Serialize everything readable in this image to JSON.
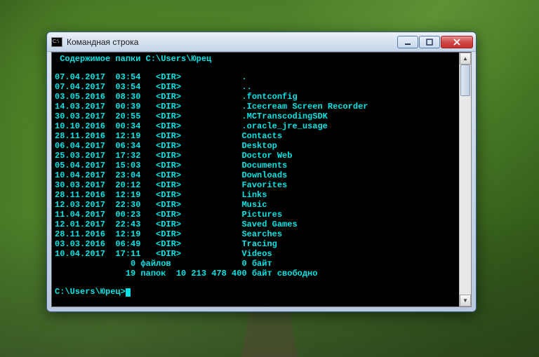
{
  "window": {
    "title": "Командная строка",
    "icon_label": "C:\\"
  },
  "console": {
    "header": "Содержимое папки C:\\Users\\Юрец",
    "entries": [
      {
        "date": "07.04.2017",
        "time": "03:54",
        "type": "<DIR>",
        "name": "."
      },
      {
        "date": "07.04.2017",
        "time": "03:54",
        "type": "<DIR>",
        "name": ".."
      },
      {
        "date": "03.05.2016",
        "time": "08:30",
        "type": "<DIR>",
        "name": ".fontconfig"
      },
      {
        "date": "14.03.2017",
        "time": "00:39",
        "type": "<DIR>",
        "name": ".Icecream Screen Recorder"
      },
      {
        "date": "30.03.2017",
        "time": "20:55",
        "type": "<DIR>",
        "name": ".MCTranscodingSDK"
      },
      {
        "date": "10.10.2016",
        "time": "00:34",
        "type": "<DIR>",
        "name": ".oracle_jre_usage"
      },
      {
        "date": "28.11.2016",
        "time": "12:19",
        "type": "<DIR>",
        "name": "Contacts"
      },
      {
        "date": "06.04.2017",
        "time": "06:34",
        "type": "<DIR>",
        "name": "Desktop"
      },
      {
        "date": "25.03.2017",
        "time": "17:32",
        "type": "<DIR>",
        "name": "Doctor Web"
      },
      {
        "date": "05.04.2017",
        "time": "15:03",
        "type": "<DIR>",
        "name": "Documents"
      },
      {
        "date": "10.04.2017",
        "time": "23:04",
        "type": "<DIR>",
        "name": "Downloads"
      },
      {
        "date": "30.03.2017",
        "time": "20:12",
        "type": "<DIR>",
        "name": "Favorites"
      },
      {
        "date": "28.11.2016",
        "time": "12:19",
        "type": "<DIR>",
        "name": "Links"
      },
      {
        "date": "12.03.2017",
        "time": "22:30",
        "type": "<DIR>",
        "name": "Music"
      },
      {
        "date": "11.04.2017",
        "time": "00:23",
        "type": "<DIR>",
        "name": "Pictures"
      },
      {
        "date": "12.01.2017",
        "time": "22:43",
        "type": "<DIR>",
        "name": "Saved Games"
      },
      {
        "date": "28.11.2016",
        "time": "12:19",
        "type": "<DIR>",
        "name": "Searches"
      },
      {
        "date": "03.03.2016",
        "time": "06:49",
        "type": "<DIR>",
        "name": "Tracing"
      },
      {
        "date": "10.04.2017",
        "time": "17:11",
        "type": "<DIR>",
        "name": "Videos"
      }
    ],
    "summary1": "               0 файлов              0 байт",
    "summary2": "              19 папок  10 213 478 400 байт свободно",
    "prompt": "C:\\Users\\Юрец>"
  }
}
